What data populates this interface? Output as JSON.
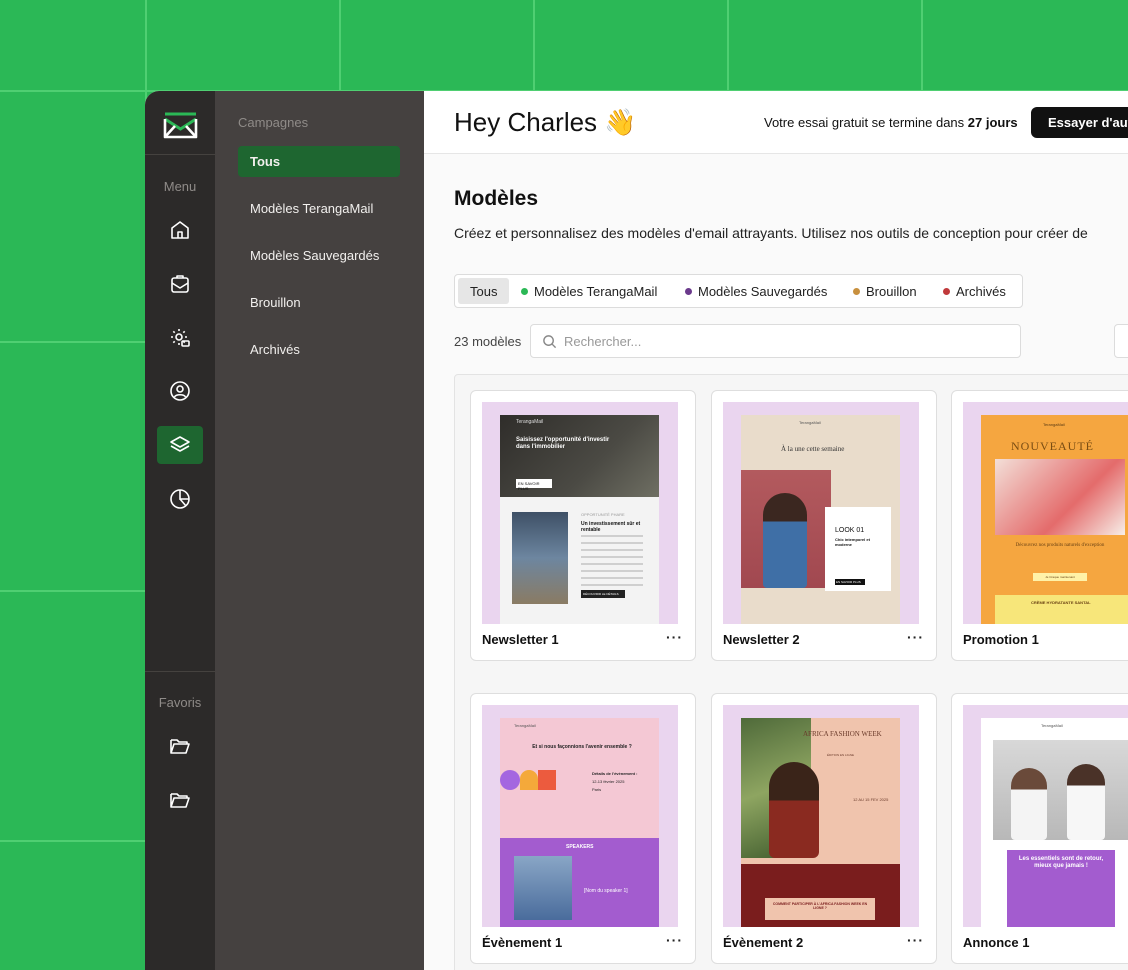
{
  "sidebar": {
    "menu_label": "Menu",
    "favorites_label": "Favoris",
    "icons": [
      "home-icon",
      "inbox-icon",
      "settings-icon",
      "contacts-icon",
      "templates-icon",
      "analytics-icon"
    ],
    "favorites": [
      "folder-icon",
      "folder-icon"
    ]
  },
  "subnav": {
    "title": "Campagnes",
    "items": [
      {
        "label": "Tous",
        "active": true
      },
      {
        "label": "Modèles TerangaMail",
        "active": false
      },
      {
        "label": "Modèles Sauvegardés",
        "active": false
      },
      {
        "label": "Brouillon",
        "active": false
      },
      {
        "label": "Archivés",
        "active": false
      }
    ]
  },
  "header": {
    "greeting": "Hey Charles",
    "greeting_emoji": "👋",
    "trial_prefix": "Votre essai gratuit se termine dans",
    "trial_days": "27 jours",
    "cta_label": "Essayer d'aut"
  },
  "page": {
    "title": "Modèles",
    "description": "Créez et personnalisez des modèles d'email attrayants. Utilisez nos outils de conception pour créer de"
  },
  "filters": [
    {
      "label": "Tous",
      "color": null,
      "active": true
    },
    {
      "label": "Modèles TerangaMail",
      "color": "#2bb856",
      "active": false
    },
    {
      "label": "Modèles Sauvegardés",
      "color": "#6b3a8c",
      "active": false
    },
    {
      "label": "Brouillon",
      "color": "#c8903e",
      "active": false
    },
    {
      "label": "Archivés",
      "color": "#c0393b",
      "active": false
    }
  ],
  "search": {
    "count": "23 modèles",
    "placeholder": "Rechercher..."
  },
  "templates": [
    {
      "name": "Newsletter 1",
      "menu": "···",
      "preview": {
        "brand": "TerangaMail",
        "headline": "Saisissez l'opportunité d'investir dans l'immobilier",
        "button": "EN SAVOIR PLUS",
        "tag": "OPPORTUNITÉ PHARE",
        "subhead": "Un investissement sûr et rentable",
        "cta": "DÉCOUVRIR LE DÉTAILS"
      }
    },
    {
      "name": "Newsletter 2",
      "menu": "···",
      "preview": {
        "brand": "TerangaMail",
        "headline": "À la une cette semaine",
        "look": "LOOK 01",
        "look_sub": "Chic intemporel et moderne",
        "button": "EN SAVOIR PLUS"
      }
    },
    {
      "name": "Promotion 1",
      "menu": "···",
      "preview": {
        "brand": "TerangaMail",
        "headline": "NOUVEAUTÉ",
        "sub": "Découvrez nos produits naturels d'exception",
        "button": "Je Craque maintenant",
        "product": "CRÈME HYDRATANTE SANTAL"
      }
    },
    {
      "name": "Évènement 1",
      "menu": "···",
      "preview": {
        "brand": "TerangaMail",
        "headline": "Et si nous façonnions l'avenir ensemble ?",
        "details": "Détails de l'évènement :",
        "date": "12-13 février 2025",
        "city": "Paris",
        "speakers": "SPEAKERS",
        "speaker": "[Nom du speaker 1]"
      }
    },
    {
      "name": "Évènement 2",
      "menu": "···",
      "preview": {
        "headline": "AFRICA FASHION WEEK",
        "sub": "ÉDITION EN LIGNE",
        "date": "12 AU 15 FEV 2025",
        "cta": "COMMENT PARTICIPER À L'AFRICA FASHION WEEK EN LIGNE ?"
      }
    },
    {
      "name": "Annonce 1",
      "menu": "···",
      "preview": {
        "brand": "TerangaMail",
        "headline": "Les essentiels sont de retour, mieux que jamais !"
      }
    }
  ],
  "colors": {
    "brand_green": "#2bb856",
    "active_green": "#1e6630",
    "rail_bg": "#2c2a29",
    "subnav_bg": "#454140"
  }
}
